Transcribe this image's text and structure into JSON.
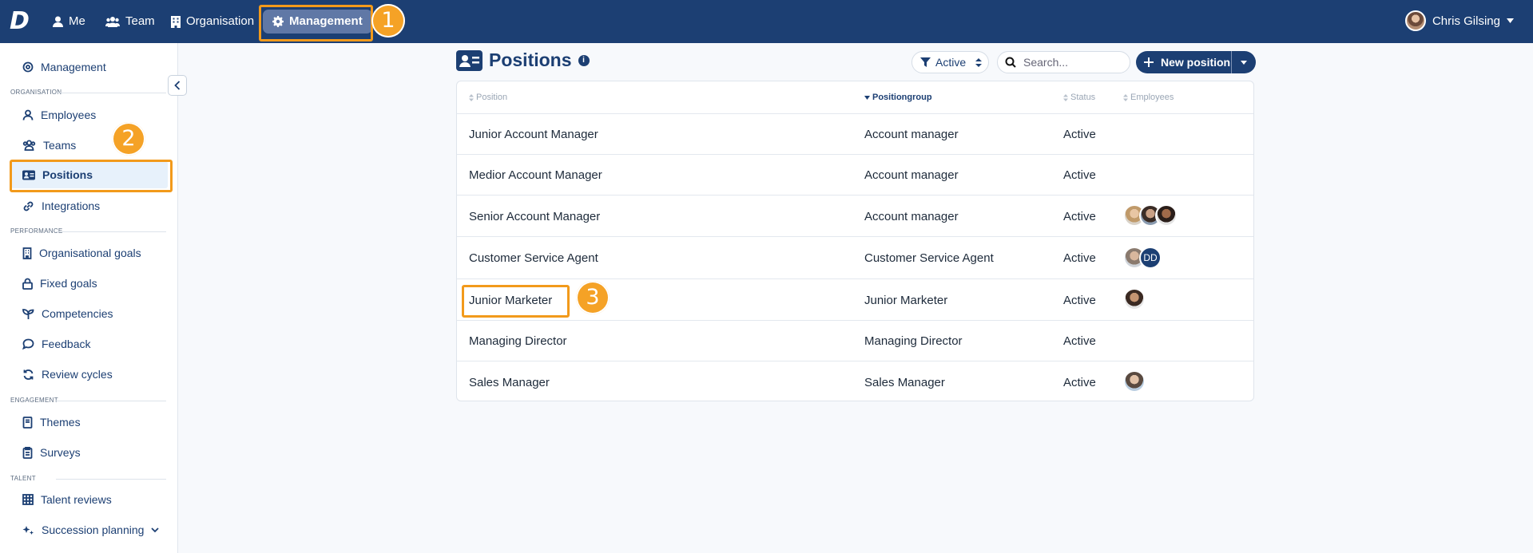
{
  "topnav": {
    "items": [
      {
        "label": "Me",
        "icon": "person-icon"
      },
      {
        "label": "Team",
        "icon": "users-icon"
      },
      {
        "label": "Organisation",
        "icon": "building-icon"
      },
      {
        "label": "Management",
        "icon": "gear-icon",
        "active": true
      }
    ],
    "user_name": "Chris Gilsing"
  },
  "callouts": [
    "1",
    "2",
    "3"
  ],
  "sidebar": {
    "top_item": "Management",
    "sections": [
      {
        "title": "Organisation",
        "items": [
          "Employees",
          "Teams",
          "Positions",
          "Integrations"
        ]
      },
      {
        "title": "Performance",
        "items": [
          "Organisational goals",
          "Fixed goals",
          "Competencies",
          "Feedback",
          "Review cycles"
        ]
      },
      {
        "title": "Engagement",
        "items": [
          "Themes",
          "Surveys"
        ]
      },
      {
        "title": "Talent",
        "items": [
          "Talent reviews",
          "Succession planning"
        ]
      }
    ],
    "active_item": "Positions"
  },
  "page": {
    "title": "Positions",
    "filter_label": "Active",
    "search_placeholder": "Search...",
    "new_button": "New position"
  },
  "table": {
    "columns": [
      "Position",
      "Positiongroup",
      "Status",
      "Employees"
    ],
    "sorted_column": "Positiongroup",
    "rows": [
      {
        "position": "Junior Account Manager",
        "group": "Account manager",
        "status": "Active",
        "employees": []
      },
      {
        "position": "Medior Account Manager",
        "group": "Account manager",
        "status": "Active",
        "employees": []
      },
      {
        "position": "Senior Account Manager",
        "group": "Account manager",
        "status": "Active",
        "employees": [
          "photo",
          "photo",
          "photo"
        ]
      },
      {
        "position": "Customer Service Agent",
        "group": "Customer Service Agent",
        "status": "Active",
        "employees": [
          "photo",
          "DD"
        ]
      },
      {
        "position": "Junior Marketer",
        "group": "Junior Marketer",
        "status": "Active",
        "employees": [
          "photo"
        ]
      },
      {
        "position": "Managing Director",
        "group": "Managing Director",
        "status": "Active",
        "employees": []
      },
      {
        "position": "Sales Manager",
        "group": "Sales Manager",
        "status": "Active",
        "employees": [
          "photo"
        ]
      }
    ]
  },
  "colors": {
    "brand": "#1c3f73",
    "highlight": "#f29a1b",
    "badge": "#f5a226"
  }
}
